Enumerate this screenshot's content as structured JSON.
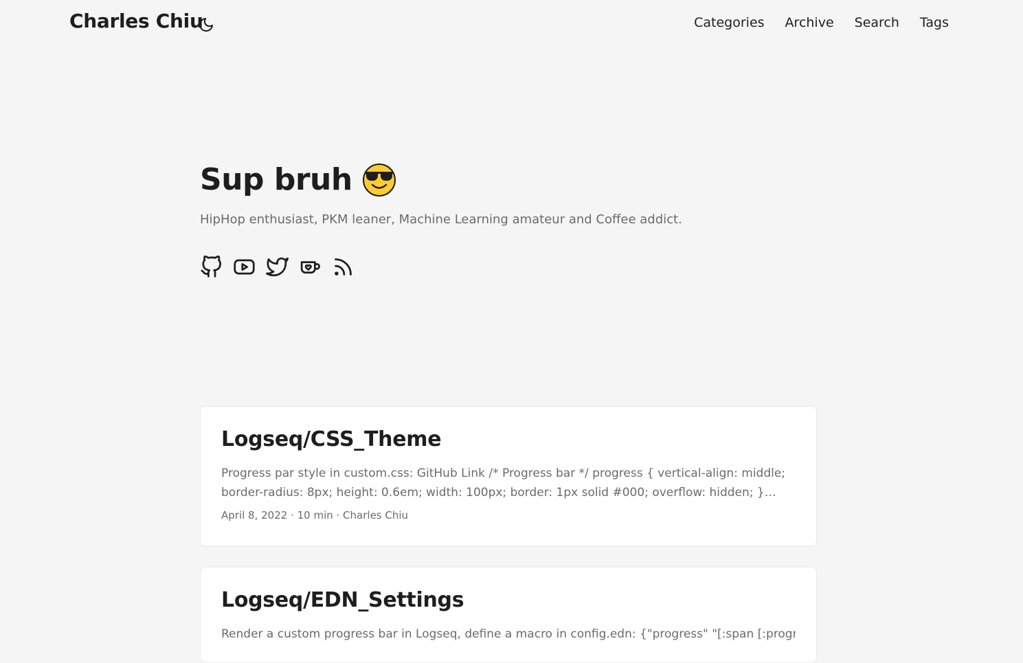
{
  "header": {
    "site_title": "Charles Chiu",
    "theme_toggle_icon": "moon-icon",
    "menu": [
      {
        "label": "Categories"
      },
      {
        "label": "Archive"
      },
      {
        "label": "Search"
      },
      {
        "label": "Tags"
      }
    ]
  },
  "profile": {
    "title": "Sup bruh",
    "emoji_icon": "sunglasses-face-icon",
    "subtitle": "HipHop enthusiast, PKM leaner, Machine Learning amateur and Coffee addict.",
    "socials": [
      {
        "icon": "github-icon"
      },
      {
        "icon": "youtube-icon"
      },
      {
        "icon": "twitter-icon"
      },
      {
        "icon": "kofi-icon"
      },
      {
        "icon": "rss-icon"
      }
    ]
  },
  "posts": [
    {
      "title": "Logseq/CSS_Theme",
      "summary": "Progress par style in custom.css: GitHub Link /* Progress bar */ progress { vertical-align: middle; border-radius: 8px; height: 0.6em; width: 100px; border: 1px solid #000; overflow: hidden; } progress::-webkit-...",
      "meta": "April 8, 2022 · 10 min · Charles Chiu"
    },
    {
      "title": "Logseq/EDN_Settings",
      "summary": "Render a custom progress bar in Logseq, define a macro in config.edn: {\"progress\" \"[:span [:progress {:value",
      "meta": ""
    }
  ],
  "colors": {
    "background": "#f5f5f5",
    "card": "#ffffff",
    "text": "#1e1e1e",
    "secondary_text": "#6b6b6b",
    "emoji_yellow": "#FFCC33"
  }
}
